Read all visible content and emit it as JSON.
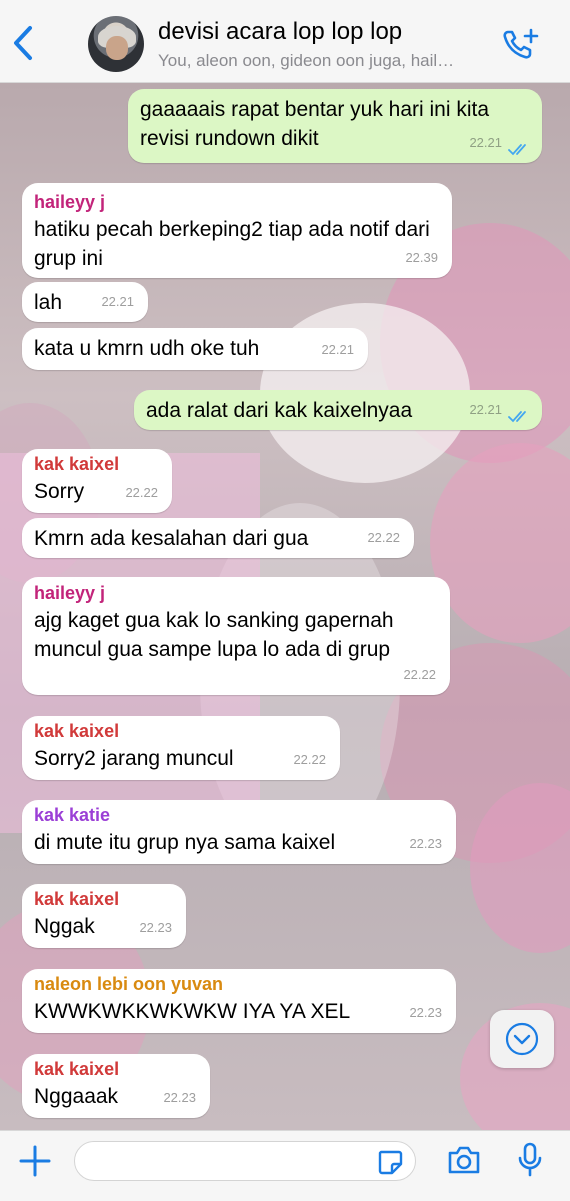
{
  "header": {
    "title": "devisi acara lop lop lop",
    "subtitle": "You, aleon oon, gideon oon juga, hail…"
  },
  "messages": [
    {
      "dir": "out",
      "text": "gaaaaais rapat bentar yuk hari ini kita revisi rundown dikit",
      "time": "22.21",
      "read": true
    },
    {
      "dir": "in",
      "sender": "haileyy j",
      "sender_color": "#c2247a",
      "text": "hatiku pecah berkeping2 tiap ada notif dari grup ini",
      "time": "22.39"
    },
    {
      "dir": "in",
      "text": "lah",
      "time": "22.21"
    },
    {
      "dir": "in",
      "text": "kata u kmrn udh oke tuh",
      "time": "22.21"
    },
    {
      "dir": "out",
      "text": "ada ralat dari kak kaixelnyaa",
      "time": "22.21",
      "read": true
    },
    {
      "dir": "in",
      "sender": "kak kaixel",
      "sender_color": "#d13a3a",
      "text": "Sorry",
      "time": "22.22"
    },
    {
      "dir": "in",
      "text": "Kmrn ada kesalahan dari gua",
      "time": "22.22"
    },
    {
      "dir": "in",
      "sender": "haileyy j",
      "sender_color": "#c2247a",
      "text": "ajg kaget gua kak lo sanking gapernah muncul gua sampe lupa lo ada di grup",
      "time": "22.22"
    },
    {
      "dir": "in",
      "sender": "kak kaixel",
      "sender_color": "#d13a3a",
      "text": "Sorry2 jarang muncul",
      "time": "22.22"
    },
    {
      "dir": "in",
      "sender": "kak katie",
      "sender_color": "#9b3fd6",
      "text": "di mute itu grup nya sama kaixel",
      "time": "22.23"
    },
    {
      "dir": "in",
      "sender": "kak kaixel",
      "sender_color": "#d13a3a",
      "text": "Nggak",
      "time": "22.23"
    },
    {
      "dir": "in",
      "sender": "naleon lebi oon yuvan",
      "sender_color": "#d98a10",
      "text": "KWWKWKKWKWKW IYA YA XEL",
      "time": "22.23"
    },
    {
      "dir": "in",
      "sender": "kak kaixel",
      "sender_color": "#d13a3a",
      "text": "Nggaaak",
      "time": "22.23"
    }
  ],
  "composer": {
    "value": "",
    "placeholder": ""
  },
  "colors": {
    "accent": "#1a7ce3",
    "outgoing_bubble": "#dcf7c5",
    "incoming_bubble": "#ffffff",
    "read_ticks": "#43a7f0"
  },
  "icons": [
    "back-chevron-icon",
    "add-call-icon",
    "plus-icon",
    "sticker-icon",
    "camera-icon",
    "microphone-icon",
    "chevron-down-icon",
    "double-check-icon"
  ]
}
